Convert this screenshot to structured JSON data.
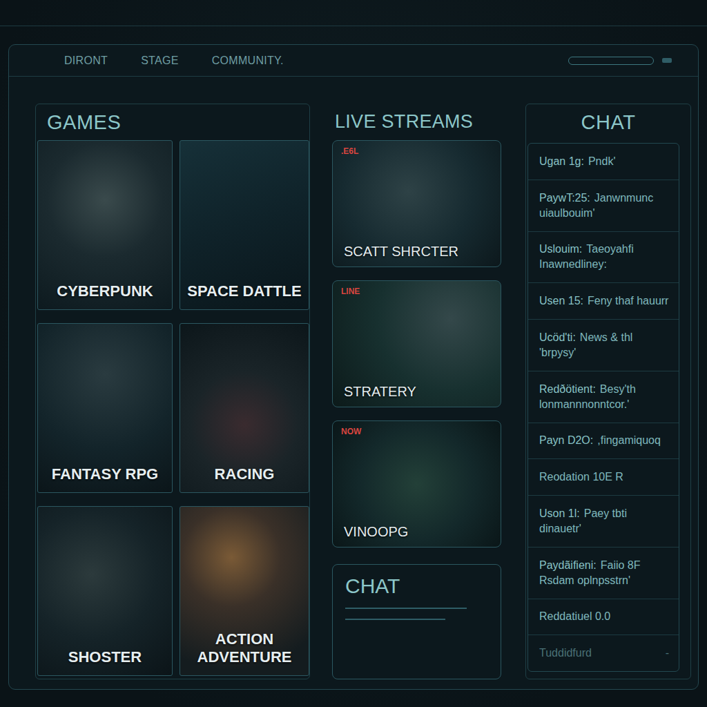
{
  "nav": [
    "DIRONT",
    "STAGE",
    "COMMUNITY."
  ],
  "games": {
    "title": "GAMES",
    "items": [
      {
        "label": "CYBERPUNK"
      },
      {
        "label": "SPACE DATTLE"
      },
      {
        "label": "FANTASY RPG"
      },
      {
        "label": "RACING"
      },
      {
        "label": "SHOSTER"
      },
      {
        "label": "ACTION ADVENTURE"
      }
    ]
  },
  "streams": {
    "title": "LIVE STREAMS",
    "items": [
      {
        "badge": ".E6L",
        "label": "SCATT SHRCTER"
      },
      {
        "badge": "LINE",
        "label": "STRATERY"
      },
      {
        "badge": "NOW",
        "label": "VINOOPG"
      }
    ]
  },
  "stream_chat": {
    "title": "CHAT"
  },
  "chat": {
    "title": "CHAT",
    "messages": [
      {
        "user": "Ugan 1g:",
        "text": "Pndk'",
        "marker": "",
        "dimmed": false
      },
      {
        "user": "PaywT:25:",
        "text": "Janwnmunc uiaulbouim'",
        "marker": "",
        "dimmed": false
      },
      {
        "user": "Uslouim:",
        "text": "Taeoyahfi Inawnedliney:",
        "marker": "",
        "dimmed": false
      },
      {
        "user": "Usen 15:",
        "text": "Feny thaf hauurr",
        "marker": "",
        "dimmed": false
      },
      {
        "user": "Ucöd'ti:",
        "text": "News & thl 'brpysy'",
        "marker": "",
        "dimmed": false
      },
      {
        "user": "Redðötient:",
        "text": "Besy'th lonmannnonntcor.'",
        "marker": "",
        "dimmed": false
      },
      {
        "user": "Payn D2O:",
        "text": ",fingamiquoq",
        "marker": "",
        "dimmed": false
      },
      {
        "user": "",
        "text": "Reodation 10E R",
        "marker": "",
        "dimmed": false
      },
      {
        "user": "Uson 1l:",
        "text": "Paey tbti dinauetr'",
        "marker": "",
        "dimmed": false
      },
      {
        "user": "Paydãifieni:",
        "text": "Faiio 8F Rsdam oplnpsstrn'",
        "marker": "",
        "dimmed": false
      },
      {
        "user": "",
        "text": "Reddatiuel 0.0",
        "marker": "",
        "dimmed": false
      },
      {
        "user": "",
        "text": "Tuddidfurd",
        "marker": "-",
        "dimmed": true
      }
    ]
  }
}
